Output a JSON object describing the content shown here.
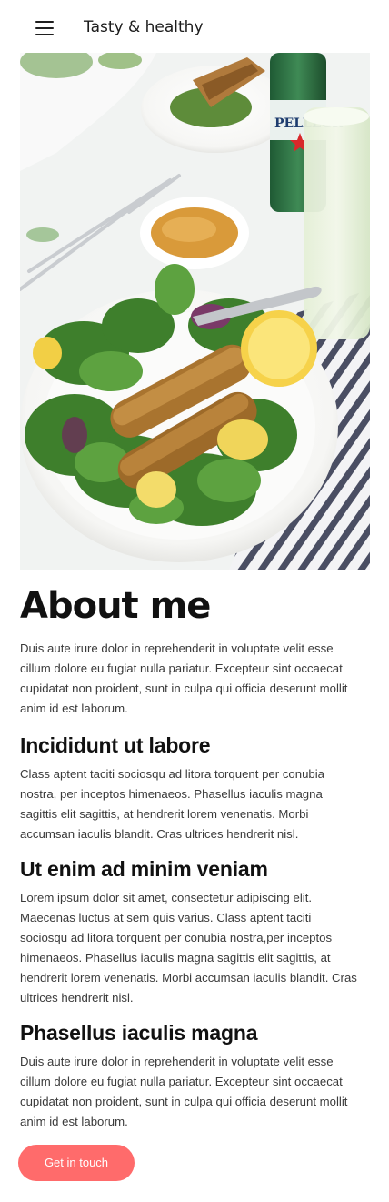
{
  "header": {
    "title": "Tasty & healthy",
    "menu_icon": "hamburger-menu-icon"
  },
  "hero": {
    "image_label": "salad-with-fried-sardines-photo",
    "bottle_text": "PELLEGR"
  },
  "about": {
    "heading": "About me",
    "text": "Duis aute irure dolor in reprehenderit in voluptate velit esse cillum dolore eu fugiat nulla pariatur. Excepteur sint occaecat cupidatat non proident, sunt in culpa qui officia deserunt mollit anim id est laborum."
  },
  "sections": [
    {
      "heading": "Incididunt ut labore",
      "text": "Class aptent taciti sociosqu ad litora torquent per conubia nostra, per inceptos himenaeos. Phasellus iaculis magna sagittis elit sagittis, at hendrerit lorem venenatis. Morbi accumsan iaculis blandit. Cras ultrices hendrerit nisl."
    },
    {
      "heading": "Ut enim ad minim veniam",
      "text": "Lorem ipsum dolor sit amet, consectetur adipiscing elit. Maecenas luctus at sem quis varius. Class aptent taciti sociosqu ad litora torquent per conubia nostra,per inceptos himenaeos. Phasellus iaculis magna sagittis elit sagittis, at hendrerit lorem venenatis. Morbi accumsan iaculis blandit. Cras ultrices hendrerit nisl."
    },
    {
      "heading": "Phasellus iaculis magna",
      "text": "Duis aute irure dolor in reprehenderit in voluptate velit esse cillum dolore eu fugiat nulla pariatur. Excepteur sint occaecat cupidatat non proident, sunt in culpa qui officia deserunt mollit anim id est laborum."
    }
  ],
  "cta": {
    "label": "Get in touch"
  },
  "colors": {
    "accent": "#ff6b6b",
    "heading": "#111111",
    "body_text": "#3a3a3a"
  }
}
